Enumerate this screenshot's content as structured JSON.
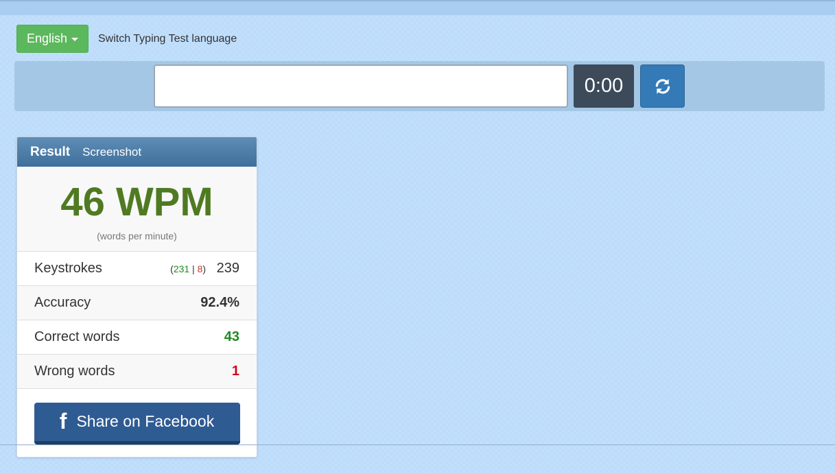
{
  "language": {
    "selected": "English",
    "hint": "Switch Typing Test language"
  },
  "test": {
    "input_value": "",
    "timer": "0:00",
    "reload_icon": "refresh-icon"
  },
  "result": {
    "title": "Result",
    "screenshot_label": "Screenshot",
    "wpm": "46 WPM",
    "wpm_sub": "(words per minute)",
    "keystrokes": {
      "label": "Keystrokes",
      "open": "(",
      "correct": "231",
      "sep": " | ",
      "wrong": "8",
      "close": ")",
      "total": "239"
    },
    "accuracy": {
      "label": "Accuracy",
      "value": "92.4%"
    },
    "correct_words": {
      "label": "Correct words",
      "value": "43"
    },
    "wrong_words": {
      "label": "Wrong words",
      "value": "1"
    },
    "share": {
      "label": "Share on Facebook",
      "icon": "facebook-icon"
    }
  },
  "colors": {
    "accent": "#337ab7",
    "success": "#5cb85c",
    "wpm": "#4f7a21",
    "facebook": "#2f5b93"
  }
}
